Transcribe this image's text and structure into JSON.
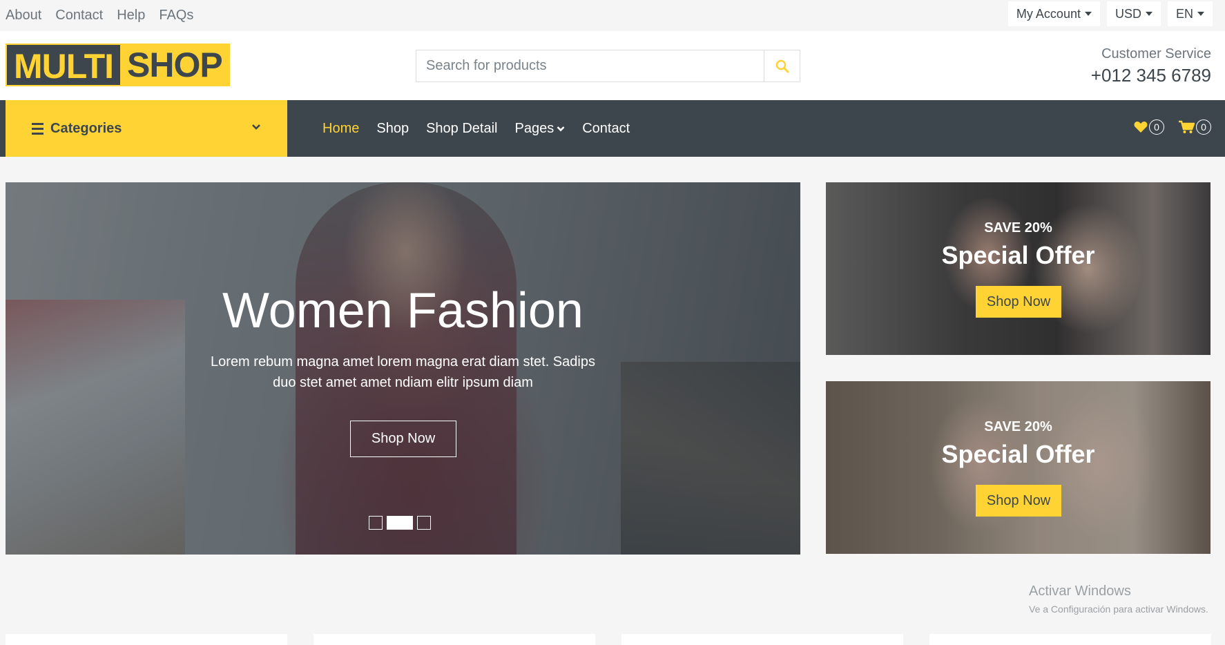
{
  "topbar": {
    "links": [
      "About",
      "Contact",
      "Help",
      "FAQs"
    ],
    "account_label": "My Account",
    "currency_label": "USD",
    "language_label": "EN"
  },
  "header": {
    "logo_part1": "MULTI",
    "logo_part2": "SHOP",
    "search_placeholder": "Search for products",
    "customer_service_label": "Customer Service",
    "phone": "+012 345 6789"
  },
  "nav": {
    "categories_label": "Categories",
    "links": [
      "Home",
      "Shop",
      "Shop Detail",
      "Pages",
      "Contact"
    ],
    "active_link": "Home",
    "wishlist_count": "0",
    "cart_count": "0"
  },
  "hero": {
    "title": "Women Fashion",
    "text": "Lorem rebum magna amet lorem magna erat diam stet. Sadips duo stet amet amet ndiam elitr ipsum diam",
    "button_label": "Shop Now",
    "slides": 3,
    "active_slide": 2
  },
  "offers": [
    {
      "save": "SAVE 20%",
      "title": "Special Offer",
      "button_label": "Shop Now"
    },
    {
      "save": "SAVE 20%",
      "title": "Special Offer",
      "button_label": "Shop Now"
    }
  ],
  "watermark": {
    "title": "Activar Windows",
    "subtitle": "Ve a Configuración para activar Windows."
  },
  "colors": {
    "accent": "#ffd333",
    "dark": "#3d464d",
    "muted": "#6c757d",
    "background": "#f5f5f5"
  }
}
